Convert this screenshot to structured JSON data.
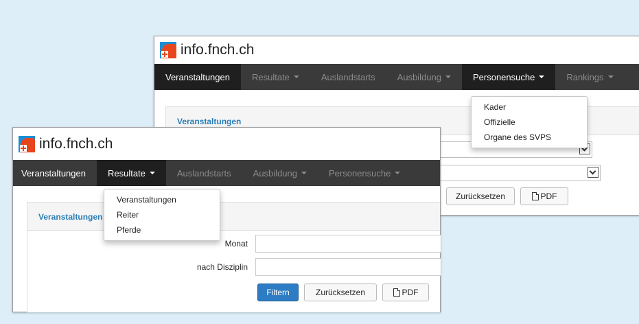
{
  "back_window": {
    "brand": "info.fnch.ch",
    "nav": [
      {
        "label": "Veranstaltungen"
      },
      {
        "label": "Resultate"
      },
      {
        "label": "Auslandstarts"
      },
      {
        "label": "Ausbildung"
      },
      {
        "label": "Personensuche"
      },
      {
        "label": "Rankings"
      }
    ],
    "panel_title": "Veranstaltungen",
    "dropdown": [
      "Kader",
      "Offizielle",
      "Organe des SVPS"
    ],
    "buttons": {
      "reset": "Zurücksetzen",
      "pdf": "PDF"
    }
  },
  "front_window": {
    "brand": "info.fnch.ch",
    "nav": [
      {
        "label": "Veranstaltungen"
      },
      {
        "label": "Resultate"
      },
      {
        "label": "Auslandstarts"
      },
      {
        "label": "Ausbildung"
      },
      {
        "label": "Personensuche"
      }
    ],
    "panel_title": "Veranstaltungen",
    "dropdown": [
      "Veranstaltungen",
      "Reiter",
      "Pferde"
    ],
    "form": {
      "month_label": "Monat",
      "discipline_label": "nach Disziplin"
    },
    "buttons": {
      "filter": "Filtern",
      "reset": "Zurücksetzen",
      "pdf": "PDF"
    }
  },
  "colors": {
    "background": "#ddeef8",
    "navbar": "#3a3a3a",
    "accent": "#2a7fb8",
    "primary_button": "#2d7cc4"
  }
}
